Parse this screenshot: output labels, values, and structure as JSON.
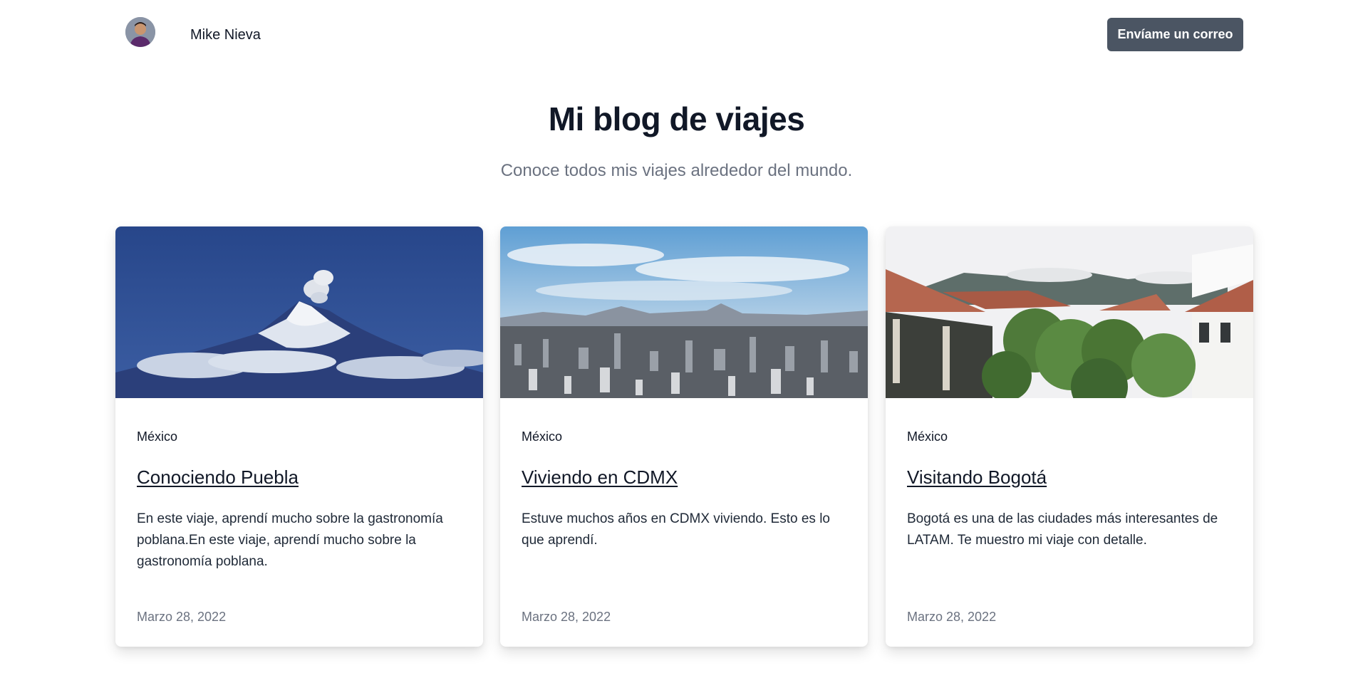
{
  "header": {
    "name": "Mike Nieva",
    "email_button": "Envíame un correo"
  },
  "hero": {
    "title": "Mi blog de viajes",
    "subtitle": "Conoce todos mis viajes alrededor del mundo."
  },
  "posts": [
    {
      "category": "México",
      "title": "Conociendo Puebla",
      "description": "En este viaje, aprendí mucho sobre la gastronomía poblana.En este viaje, aprendí mucho sobre la gastronomía poblana.",
      "date": "Marzo 28, 2022",
      "image": "volcano-photo"
    },
    {
      "category": "México",
      "title": "Viviendo en CDMX",
      "description": "Estuve muchos años en CDMX viviendo. Esto es lo que aprendí.",
      "date": "Marzo 28, 2022",
      "image": "city-skyline-photo"
    },
    {
      "category": "México",
      "title": "Visitando Bogotá",
      "description": "Bogotá es una de las ciudades más interesantes de LATAM. Te muestro mi viaje con detalle.",
      "date": "Marzo 28, 2022",
      "image": "colonial-house-photo"
    }
  ]
}
